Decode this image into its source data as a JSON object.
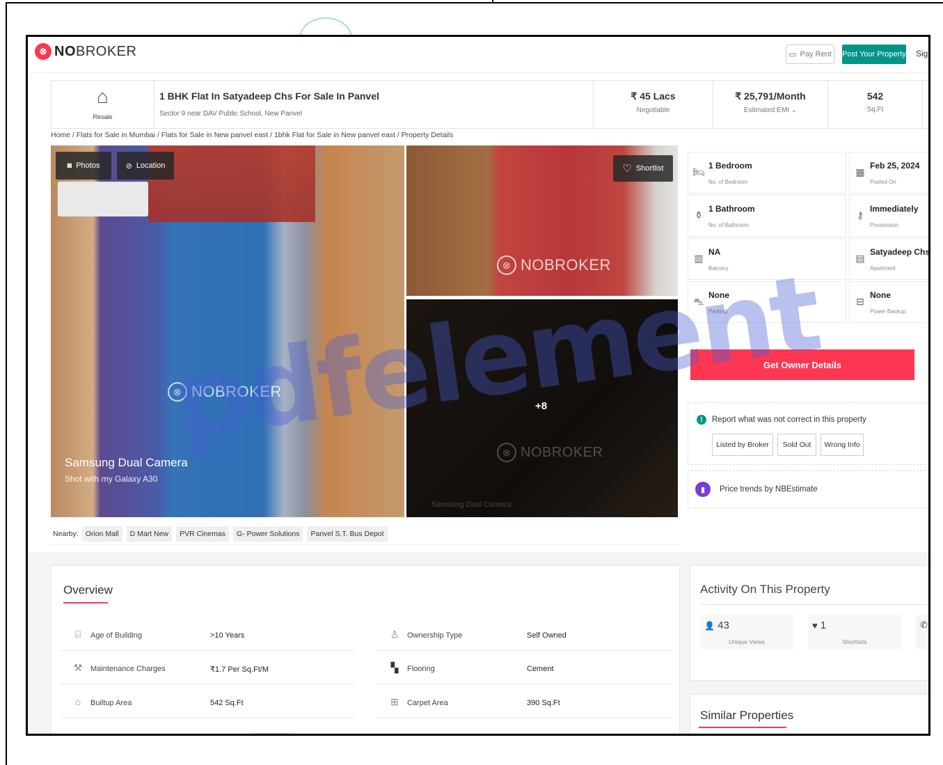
{
  "header": {
    "logo_bold": "NO",
    "logo_rest": "BROKER",
    "pay_rent": "Pay Rent",
    "post_property": "Post Your Property",
    "sign": "Sign"
  },
  "summary": {
    "resale": "Resale",
    "title": "1 BHK Flat In Satyadeep Chs For Sale In Panvel",
    "address": "Sector 9 near DAV Public School, New Panvel",
    "price": "₹ 45 Lacs",
    "price_note": "Negotiable",
    "emi": "₹ 25,791/Month",
    "emi_note": "Estimated EMI ⌄",
    "area": "542",
    "area_unit": "Sq.Ft"
  },
  "breadcrumb": "Home / Flats for Sale in Mumbai / Flats for Sale in New panvel east / 1bhk Flat for Sale in New panvel east / Property Details",
  "gallery": {
    "photos": "Photos",
    "location": "Location",
    "shortlist": "Shortlist",
    "watermark": "NOBROKER",
    "camera_title": "Samsung Dual Camera",
    "camera_sub": "Shot with my Galaxy A30",
    "more_count": "+8",
    "faint_camera": "Samsung Dual Camera"
  },
  "nearby": {
    "label": "Nearby:",
    "places": [
      "Orion Mall",
      "D Mart New",
      "PVR Cinemas",
      "G- Power Solutions",
      "Panvel S.T. Bus Depot"
    ]
  },
  "details": [
    {
      "value": "1 Bedroom",
      "label": "No. of Bedroom",
      "icon": "bed-icon"
    },
    {
      "value": "Feb 25, 2024",
      "label": "Posted On",
      "icon": "calendar-icon"
    },
    {
      "value": "1 Bathroom",
      "label": "No. of Bathroom",
      "icon": "bath-icon"
    },
    {
      "value": "Immediately",
      "label": "Possession",
      "icon": "key-icon"
    },
    {
      "value": "NA",
      "label": "Balcony",
      "icon": "balcony-icon"
    },
    {
      "value": "Satyadeep Chs",
      "label": "Apartment",
      "icon": "building-icon"
    },
    {
      "value": "None",
      "label": "Parking",
      "icon": "car-icon"
    },
    {
      "value": "None",
      "label": "Power Backup",
      "icon": "battery-icon"
    }
  ],
  "owner_button": "Get Owner Details",
  "report": {
    "heading": "Report what was not correct in this property",
    "buttons": [
      "Listed by Broker",
      "Sold Out",
      "Wrong Info"
    ]
  },
  "price_trends": "Price trends by NBEstimate",
  "overview": {
    "title": "Overview",
    "rows": [
      {
        "label": "Age of Building",
        "value": ">10 Years",
        "icon": "building-age-icon"
      },
      {
        "label": "Ownership Type",
        "value": "Self Owned",
        "icon": "ownership-icon"
      },
      {
        "label": "Maintenance Charges",
        "value": "₹1.7 Per Sq.Ft/M",
        "icon": "maintenance-icon"
      },
      {
        "label": "Flooring",
        "value": "Cement",
        "icon": "flooring-icon"
      },
      {
        "label": "Builtup Area",
        "value": "542 Sq.Ft",
        "icon": "builtup-icon"
      },
      {
        "label": "Carpet Area",
        "value": "390 Sq.Ft",
        "icon": "carpet-icon"
      }
    ]
  },
  "activity": {
    "title": "Activity On This Property",
    "views": "43",
    "views_label": "Unique Views",
    "shortlists": "1",
    "shortlists_label": "Shortlists"
  },
  "similar_title": "Similar Properties",
  "watermark_text": "pdfelement",
  "colors": {
    "brand_red": "#fd3752",
    "teal": "#009587"
  }
}
